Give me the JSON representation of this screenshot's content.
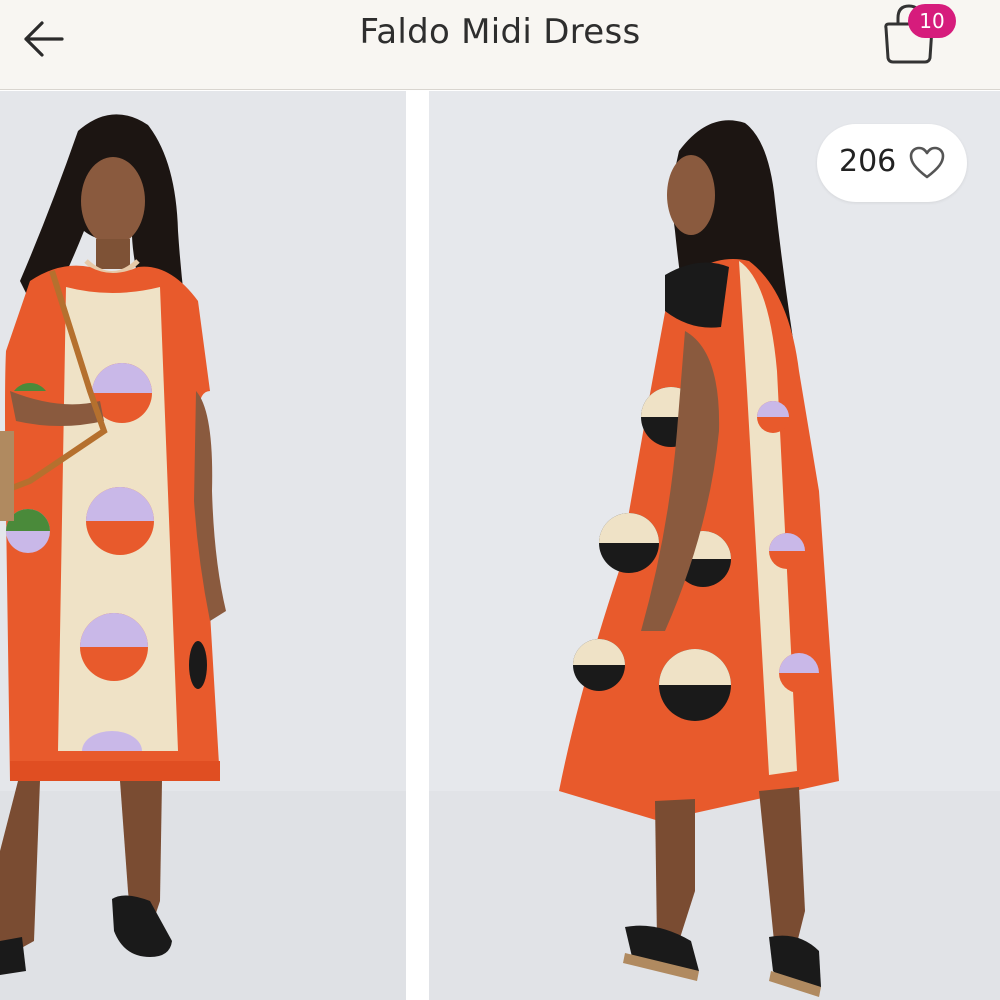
{
  "header": {
    "title": "Faldo Midi Dress",
    "back_icon": "back-arrow-icon",
    "bag_icon": "shopping-bag-icon",
    "bag_count": "10",
    "badge_color": "#d61c7c"
  },
  "gallery": {
    "images": [
      {
        "subject": "model-front-view",
        "palette": [
          "#e85a2c",
          "#efe2c6",
          "#c9b8e8",
          "#1a1a1a"
        ]
      },
      {
        "subject": "model-back-view",
        "palette": [
          "#e85a2c",
          "#efe2c6",
          "#c9b8e8",
          "#1a1a1a"
        ]
      }
    ]
  },
  "likes": {
    "count": "206",
    "icon": "heart-outline-icon"
  }
}
